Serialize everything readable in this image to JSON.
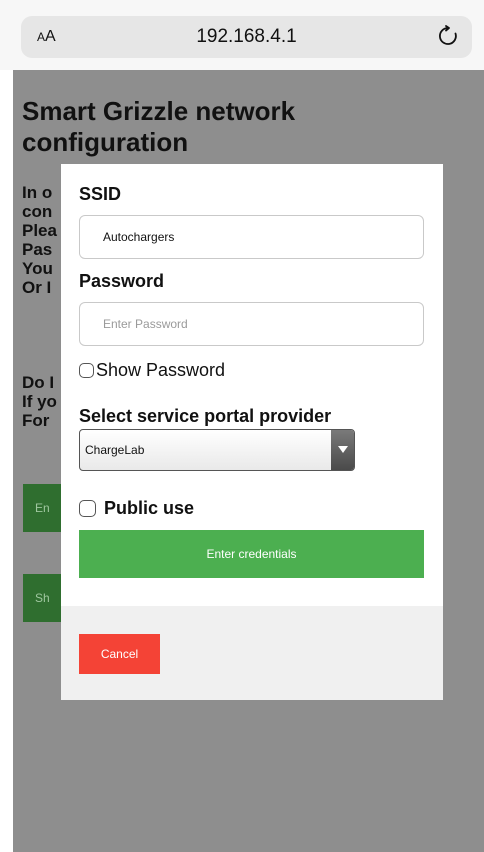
{
  "browser": {
    "aa_label_small": "A",
    "aa_label_large": "A",
    "url": "192.168.4.1",
    "reload_icon": "reload-icon"
  },
  "page": {
    "title": "Smart Grizzle network configuration",
    "text_lines": [
      "In o",
      "con",
      "Plea",
      "Pas",
      "You",
      "Or I"
    ],
    "text_lines2": [
      "Do I",
      "If yo",
      "For"
    ],
    "button1_label": "En",
    "button2_label": "Sh"
  },
  "modal": {
    "ssid_label": "SSID",
    "ssid_value": "Autochargers",
    "password_label": "Password",
    "password_placeholder": "Enter Password",
    "show_password_label": "Show Password",
    "provider_label": "Select service portal provider",
    "provider_selected": "ChargeLab",
    "public_use_label": "Public use",
    "enter_button": "Enter credentials",
    "cancel_button": "Cancel"
  },
  "colors": {
    "overlay": "#8e8e8e",
    "enter_button": "#4caf50",
    "cancel_button": "#f44336"
  }
}
